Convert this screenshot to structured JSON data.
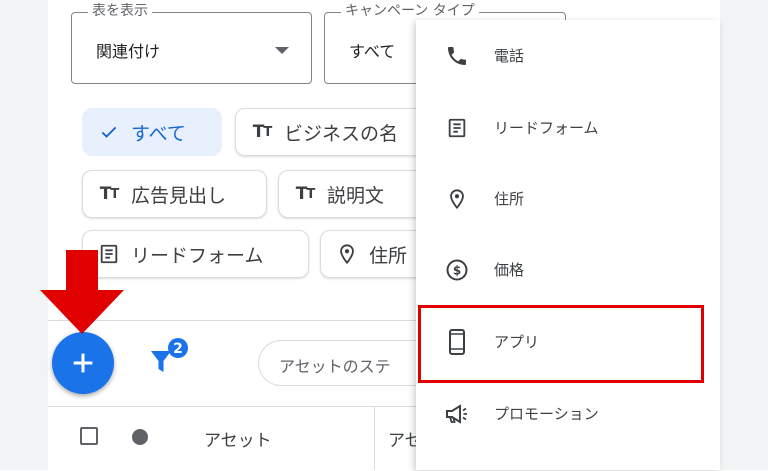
{
  "filters": {
    "table_view": {
      "label": "表を表示",
      "value": "関連付け"
    },
    "campaign_type": {
      "label": "キャンペーン タイプ",
      "value": "すべて"
    }
  },
  "chips": [
    {
      "label": "すべて",
      "icon": "check-icon",
      "selected": true
    },
    {
      "label": "ビジネスの名",
      "icon": "text-type-icon",
      "selected": false
    },
    {
      "label": "広告見出し",
      "icon": "text-type-icon",
      "selected": false
    },
    {
      "label": "説明文",
      "icon": "text-type-icon",
      "selected": false
    },
    {
      "label": "リードフォーム",
      "icon": "form-icon",
      "selected": false
    },
    {
      "label": "住所",
      "icon": "location-pin-icon",
      "selected": false
    }
  ],
  "toolbar": {
    "filter_badge": "2",
    "search_placeholder": "アセットのステ"
  },
  "table": {
    "columns": [
      "アセット",
      "アセ"
    ]
  },
  "menu": {
    "items": [
      {
        "label": "電話",
        "icon": "phone-icon"
      },
      {
        "label": "リードフォーム",
        "icon": "form-icon"
      },
      {
        "label": "住所",
        "icon": "location-pin-icon"
      },
      {
        "label": "価格",
        "icon": "price-icon"
      },
      {
        "label": "アプリ",
        "icon": "mobile-app-icon",
        "highlighted": true
      },
      {
        "label": "プロモーション",
        "icon": "megaphone-icon"
      }
    ]
  },
  "colors": {
    "primary": "#1a73e8",
    "chip_selected_bg": "#e8f0fe",
    "chip_selected_text": "#1967d2",
    "annotation_red": "#e00000"
  }
}
